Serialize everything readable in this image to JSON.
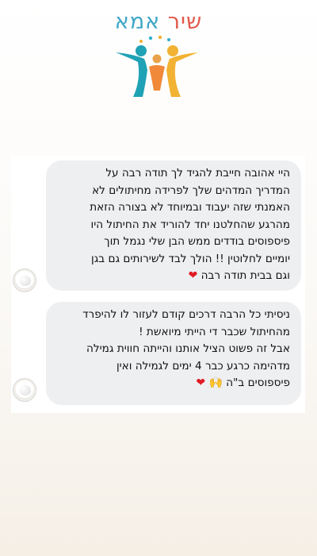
{
  "logo": {
    "word_1": "אמא",
    "word_2": "שיר"
  },
  "messages": [
    {
      "lines": [
        "היי אהובה חייבת להגיד לך תודה רבה על",
        "המדריך המדהים שלך לפרידה מחיתולים לא",
        "האמנתי שזה יעבוד ובמיוחד לא בצורה הזאת",
        "מהרגע שהחלטנו יחד להוריד את החיתול היו",
        "פיספוסים בודדים ממש הבן שלי נגמל תוך",
        "יומיים לחלוטין !! הולך לבד לשירותים גם בגן",
        "וגם בבית תודה רבה"
      ],
      "emoji": [
        "❤"
      ]
    },
    {
      "lines": [
        "ניסיתי כל הרבה דרכים קודם לעזור לו להיפרד",
        "מהחיתול שכבר די הייתי מיואשת !",
        "אבל זה פשוט הציל אותנו והייתה חווית גמילה",
        "מדהימה כרגע כבר 4 ימים לגמילה ואין",
        "פיספוסים ב\"ה"
      ],
      "emoji": [
        "🙌",
        "❤"
      ]
    }
  ],
  "colors": {
    "bubble": "#eeeff1",
    "logo_red": "#e2584a",
    "logo_blue": "#3fa6c8",
    "heart": "#e01b24"
  }
}
